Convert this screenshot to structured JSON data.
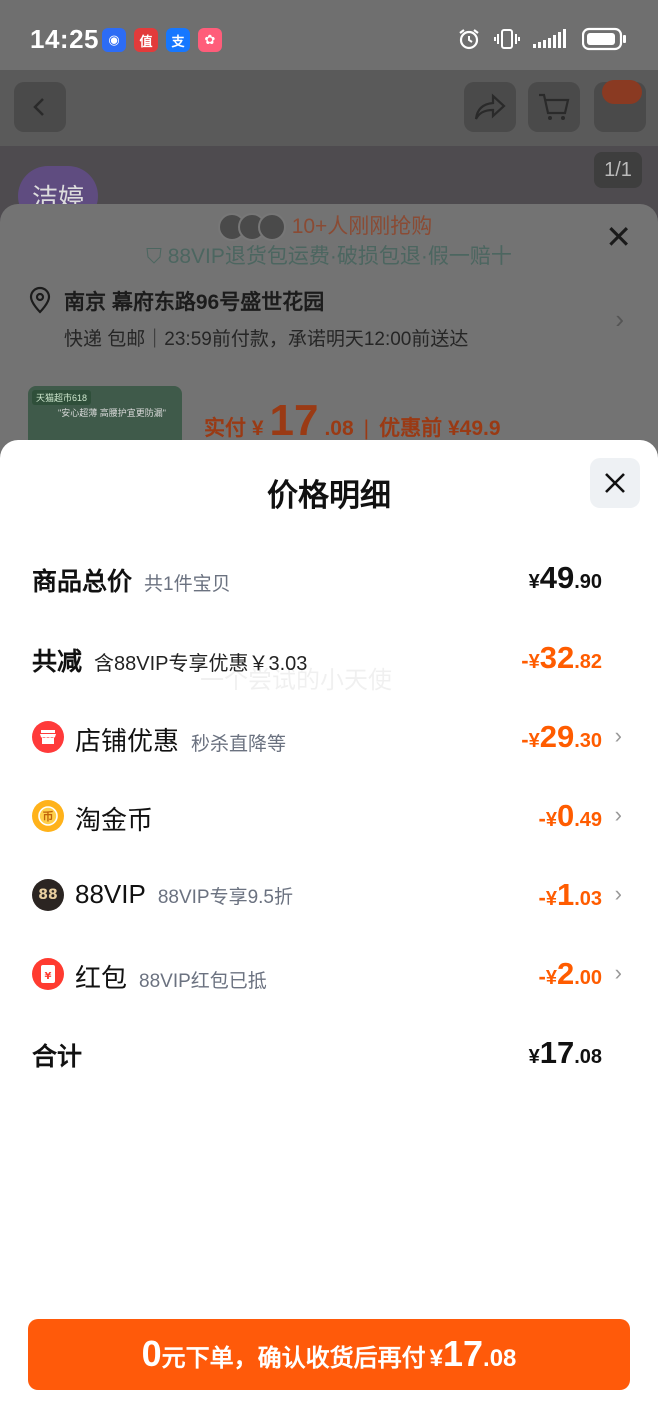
{
  "status_bar": {
    "time": "14:25",
    "apps": [
      {
        "icon": "app-icon-blue",
        "glyph": "◉",
        "color": "#2d6cf5"
      },
      {
        "icon": "zhide-icon",
        "glyph": "值",
        "color": "#e23b3b"
      },
      {
        "icon": "alipay-icon",
        "glyph": "支",
        "color": "#1677ff"
      },
      {
        "icon": "app-icon-pink",
        "glyph": "✿",
        "color": "#ff5d7a"
      }
    ]
  },
  "background": {
    "hero_tag": "洁婷",
    "page_indicator": "1/1",
    "buyers_text": "10+人刚刚抢购",
    "promise_text": "88VIP退货包运费·破损包退·假一赔十",
    "address_title": "南京 幕府东路96号盛世花园",
    "address_sub": "快递 包邮｜23:59前付款，承诺明天12:00前送达",
    "thumb_tag": "天猫超市618",
    "thumb_text": "\"安心超薄\n高腰护宜更防漏\"",
    "paid_label": "实付 ¥",
    "paid_int": "17",
    "paid_dec": ".08",
    "before_label": "优惠前 ¥49.9"
  },
  "sheet": {
    "title": "价格明细",
    "rows": [
      {
        "label": "商品总价",
        "sub": "共1件宝贝",
        "sign": "",
        "cur": "¥",
        "int": "49",
        "dec": ".90"
      },
      {
        "label": "共减",
        "sub": "含88VIP专享优惠￥3.03",
        "sign": "-",
        "cur": "¥",
        "int": "32",
        "dec": ".82"
      },
      {
        "label": "店铺优惠",
        "sub": "秒杀直降等",
        "sign": "-",
        "cur": "¥",
        "int": "29",
        "dec": ".30",
        "icon": "shop-icon"
      },
      {
        "label": "淘金币",
        "sub": "",
        "sign": "-",
        "cur": "¥",
        "int": "0",
        "dec": ".49",
        "icon": "coin-icon"
      },
      {
        "label": "88VIP",
        "sub": "88VIP专享9.5折",
        "sign": "-",
        "cur": "¥",
        "int": "1",
        "dec": ".03",
        "icon": "vip-88-icon"
      },
      {
        "label": "红包",
        "sub": "88VIP红包已抵",
        "sign": "-",
        "cur": "¥",
        "int": "2",
        "dec": ".00",
        "icon": "red-packet-icon"
      },
      {
        "label": "合计",
        "sub": "",
        "sign": "",
        "cur": "¥",
        "int": "17",
        "dec": ".08"
      }
    ],
    "watermark": "一个尝试的小天使"
  },
  "cta": {
    "zero": "0",
    "text": "元下单，确认收货后再付",
    "cur": "¥",
    "int": "17",
    "dec": ".08"
  },
  "colors": {
    "accent": "#ff5a0a",
    "discount": "#ff5c00"
  }
}
